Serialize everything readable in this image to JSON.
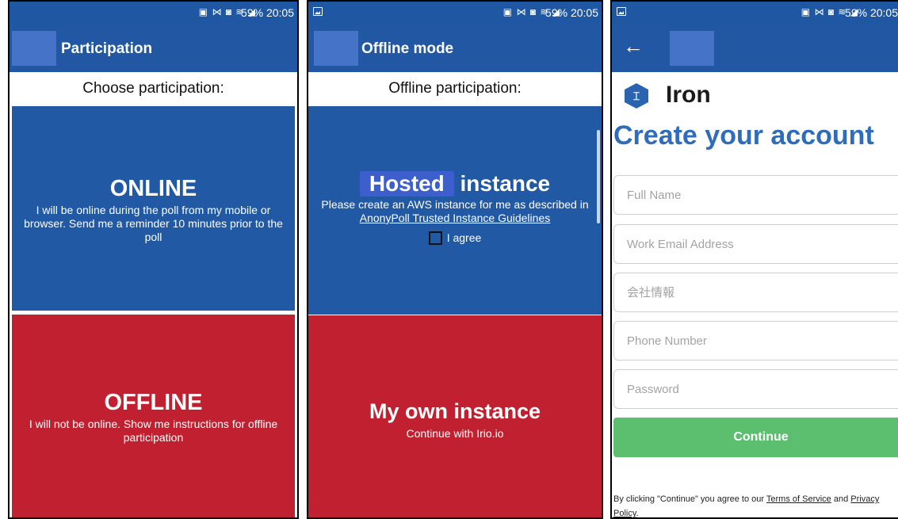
{
  "status_bar": {
    "sys_icons": "▣ ⋈ ◙ ≋ ◢",
    "battery": "59%",
    "time": "20:05"
  },
  "screen1": {
    "title": "Participation",
    "prompt": "Choose participation:",
    "online": {
      "title": "ONLINE",
      "description": "I will be online during the poll from my mobile or browser. Send me a reminder 10 minutes prior to the poll"
    },
    "offline": {
      "title": "OFFLINE",
      "description": "I will not be online. Show me instructions for offline participation"
    }
  },
  "screen2": {
    "title": "Offline mode",
    "prompt": "Offline participation:",
    "hosted": {
      "title_highlight": "Hosted",
      "title_rest": "instance",
      "description": "Please create an AWS instance for me as described in",
      "link": "AnonyPoll Trusted Instance Guidelines",
      "agree_label": "I agree"
    },
    "own": {
      "title": "My own instance",
      "subtitle": "Continue with Irio.io"
    }
  },
  "screen3": {
    "back_icon": "arrow-left-icon",
    "brand_icon": "iron-logo-icon",
    "brand_glyph": "⌶",
    "brand": "Iron",
    "heading": "Create your account",
    "fields": {
      "full_name": "Full Name",
      "work_email": "Work Email Address",
      "company": "会社情報",
      "phone": "Phone Number",
      "password": "Password"
    },
    "continue_label": "Continue",
    "legal_prefix": "By clicking \"Continue\" you agree to our",
    "terms_label": "Terms of Service",
    "legal_and": "and",
    "privacy_label": "Privacy Policy",
    "legal_suffix": "."
  },
  "colors": {
    "app_bar": "#2157a3",
    "avatar": "#4573c8",
    "online_blue": "#2159a5",
    "offline_red": "#c0202f",
    "hosted_highlight": "#3d5fce",
    "heading_blue": "#2f6cba",
    "continue_green": "#5cbe6f"
  }
}
